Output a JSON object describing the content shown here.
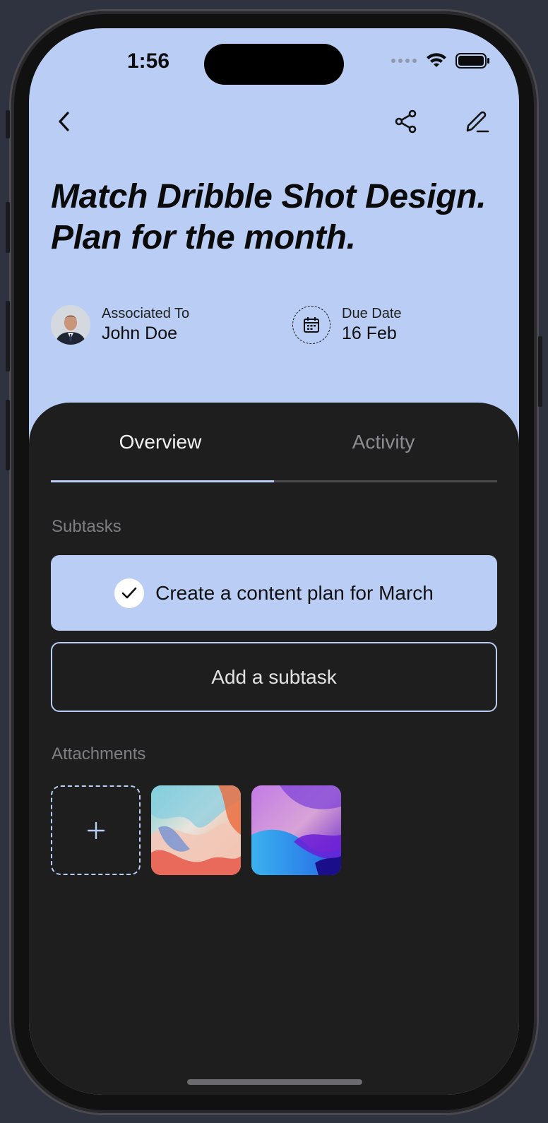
{
  "status_bar": {
    "time": "1:56"
  },
  "header": {
    "back_icon": "chevron-left-icon",
    "share_icon": "share-icon",
    "edit_icon": "pen-icon"
  },
  "task": {
    "title": "Match Dribble Shot Design. Plan for the month.",
    "associated_label": "Associated To",
    "associated_value": "John Doe",
    "due_label": "Due Date",
    "due_value": "16 Feb"
  },
  "tabs": [
    {
      "label": "Overview",
      "active": true
    },
    {
      "label": "Activity",
      "active": false
    }
  ],
  "subtasks": {
    "heading": "Subtasks",
    "items": [
      {
        "label": "Create a content plan for March",
        "done": true
      }
    ],
    "add_label": "Add a subtask"
  },
  "attachments": {
    "heading": "Attachments",
    "add_icon": "plus-icon",
    "items": [
      "abstract-pastel-swirl-image",
      "abstract-purple-blue-wave-image"
    ]
  },
  "colors": {
    "accent": "#bacdf5",
    "sheet": "#1e1e1f",
    "muted_text": "#7f7f83"
  }
}
